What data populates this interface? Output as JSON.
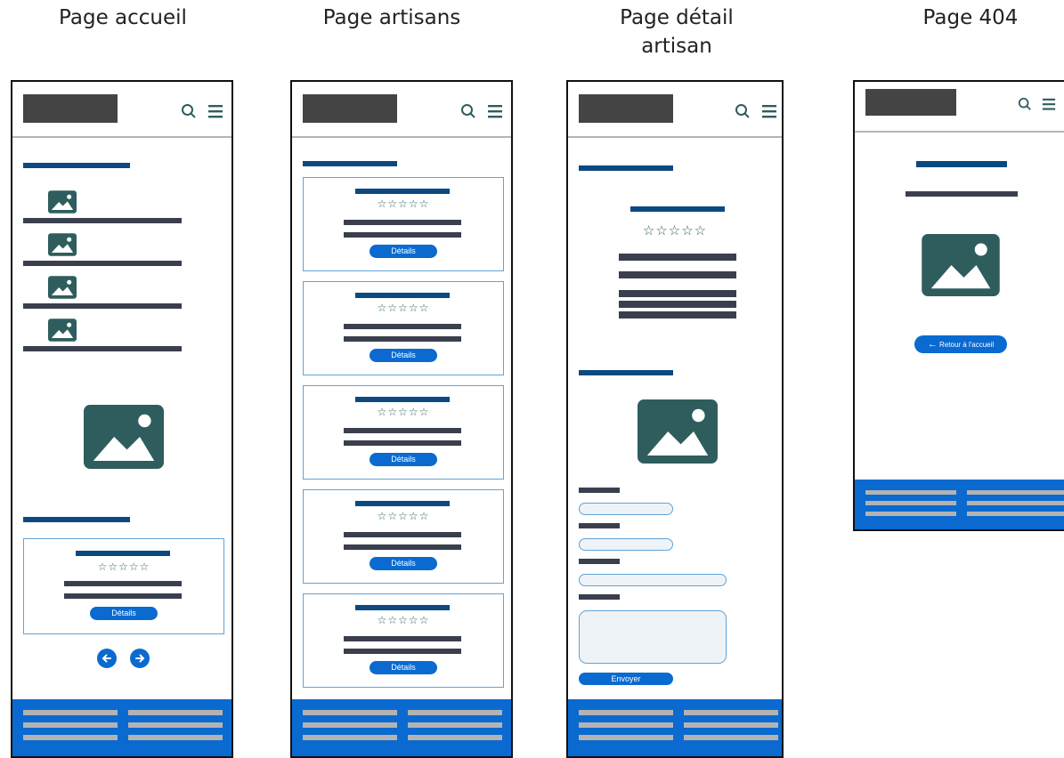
{
  "pages": [
    {
      "title": "Page accueil"
    },
    {
      "title": "Page artisans"
    },
    {
      "title": "Page détail\nartisan"
    },
    {
      "title": "Page 404"
    }
  ],
  "card_button_label": "Détails",
  "stars": "☆☆☆☆☆",
  "send_button_label": "Envoyer",
  "back_home_label": "Retour à l'accueil",
  "icons": [
    "search-icon",
    "menu-icon",
    "image-icon",
    "arrow-left-icon",
    "arrow-right-icon"
  ],
  "colors": {
    "primary_blue": "#0a6ad0",
    "navy": "#0b4a80",
    "text_bar": "#3a3f4e",
    "logo": "#444444",
    "image_icon": "#2f5d5d",
    "card_border": "#5fa3d9",
    "footer_lines": "#b3b3b3"
  }
}
